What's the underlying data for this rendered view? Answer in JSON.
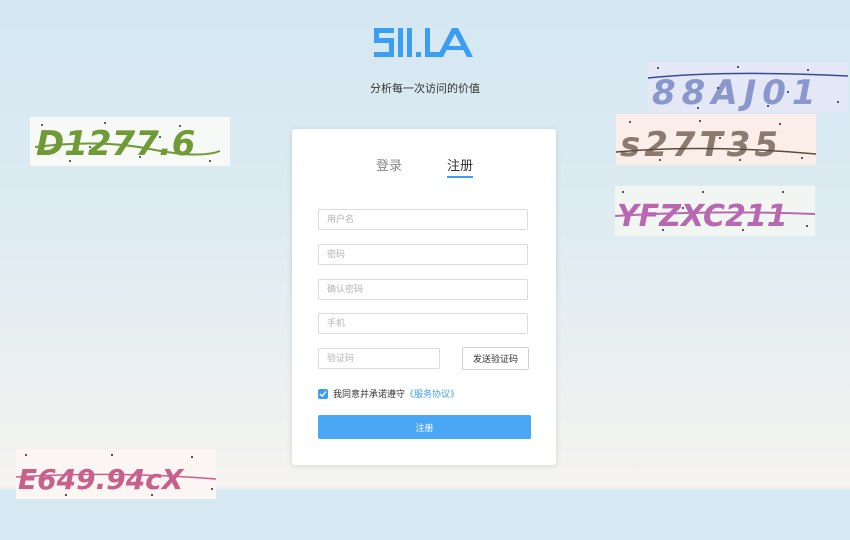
{
  "brand": {
    "logo_text": "51.LA",
    "slogan": "分析每一次访问的价值",
    "accent_color": "#3c9ef3"
  },
  "tabs": {
    "login": "登录",
    "register": "注册",
    "active": "register"
  },
  "form": {
    "username_placeholder": "用户名",
    "password_placeholder": "密码",
    "confirm_password_placeholder": "确认密码",
    "phone_placeholder": "手机",
    "code_placeholder": "验证码",
    "send_code_label": "发送验证码",
    "agree_checked": true,
    "agree_text": "我同意并承诺遵守",
    "agree_link": "《服务协议》",
    "submit_label": "注册"
  },
  "captchas": [
    {
      "text": "D1277.6",
      "color": "#6f9a36"
    },
    {
      "text": "88AJ01",
      "color": "#8a97cc"
    },
    {
      "text": "s27T35",
      "color": "#8a7a70"
    },
    {
      "text": "YFZXC211",
      "color": "#b868b0"
    },
    {
      "text": "E649.94cX",
      "color": "#c8608a"
    }
  ],
  "icons": {
    "checkbox": "check-icon"
  }
}
